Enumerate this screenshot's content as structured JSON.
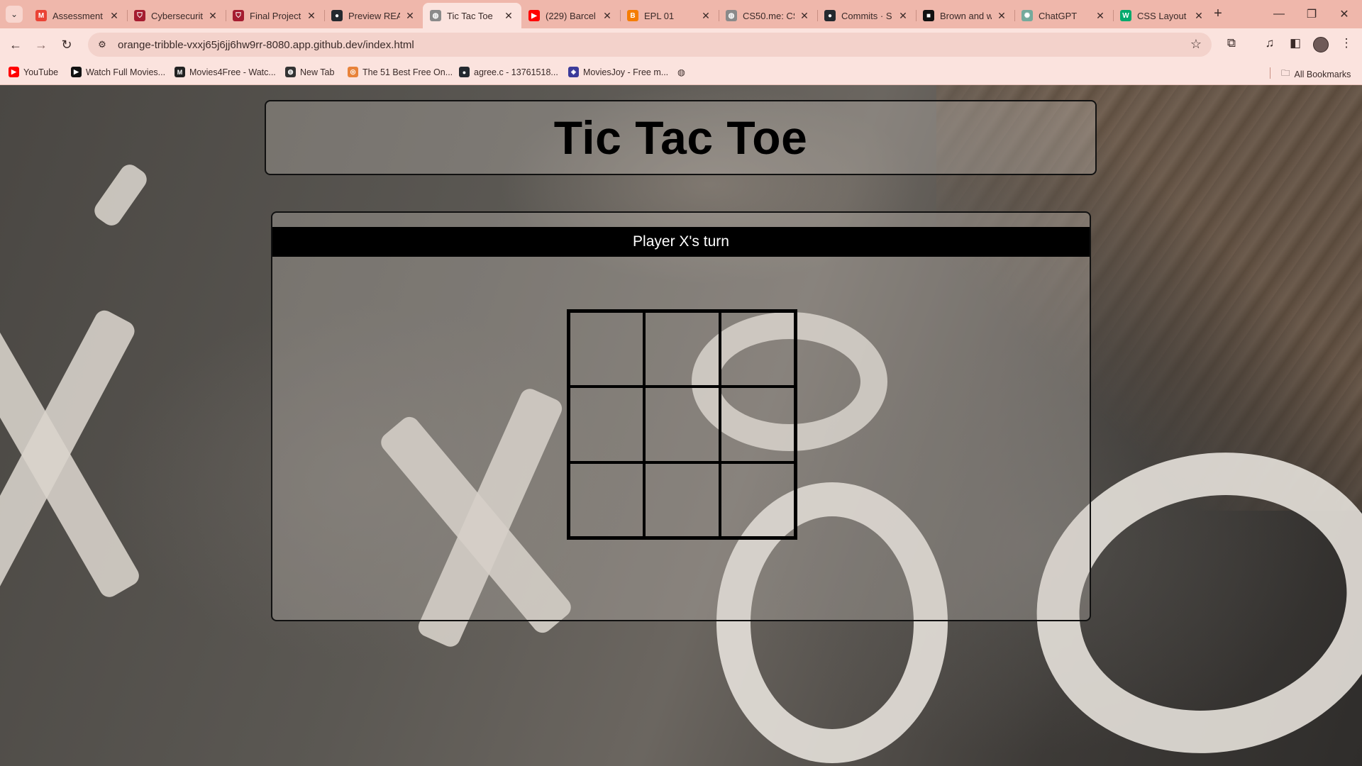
{
  "browser": {
    "tabs": [
      {
        "title": "Assessment",
        "favicon": "gmail-icon",
        "color": "#ea4335",
        "glyph": "M"
      },
      {
        "title": "Cybersecurit",
        "favicon": "harvard-shield-icon",
        "color": "#a51c30",
        "glyph": "⛉"
      },
      {
        "title": "Final Project",
        "favicon": "harvard-shield-icon",
        "color": "#a51c30",
        "glyph": "⛉"
      },
      {
        "title": "Preview REA",
        "favicon": "github-icon",
        "color": "#24292f",
        "glyph": "●"
      },
      {
        "title": "Tic Tac Toe",
        "favicon": "globe-icon",
        "color": "#8a8a8a",
        "glyph": "◍",
        "active": true
      },
      {
        "title": "(229) Barcel",
        "favicon": "youtube-icon",
        "color": "#ff0000",
        "glyph": "▶"
      },
      {
        "title": "EPL 01",
        "favicon": "blogger-icon",
        "color": "#f57d00",
        "glyph": "B"
      },
      {
        "title": "CS50.me: CS",
        "favicon": "globe-icon",
        "color": "#8a8a8a",
        "glyph": "◍"
      },
      {
        "title": "Commits · S",
        "favicon": "github-icon",
        "color": "#24292f",
        "glyph": "●"
      },
      {
        "title": "Brown and w",
        "favicon": "unsplash-icon",
        "color": "#111111",
        "glyph": "■"
      },
      {
        "title": "ChatGPT",
        "favicon": "chatgpt-icon",
        "color": "#74aa9c",
        "glyph": "✺"
      },
      {
        "title": "CSS Layout",
        "favicon": "w3schools-icon",
        "color": "#04aa6d",
        "glyph": "W"
      }
    ],
    "url": "orange-tribble-vxxj65j6jj6hw9rr-8080.app.github.dev/index.html",
    "bookmarks": [
      {
        "label": "YouTube",
        "favicon": "youtube-icon",
        "color": "#ff0000",
        "glyph": "▶"
      },
      {
        "label": "Watch Full Movies...",
        "favicon": "play-icon",
        "color": "#111111",
        "glyph": "▶"
      },
      {
        "label": "Movies4Free - Watc...",
        "favicon": "movies4free-icon",
        "color": "#222222",
        "glyph": "M"
      },
      {
        "label": "New Tab",
        "favicon": "globe-icon",
        "color": "#333333",
        "glyph": "◍"
      },
      {
        "label": "The 51 Best Free On...",
        "favicon": "list-icon",
        "color": "#e8833a",
        "glyph": "◎"
      },
      {
        "label": "agree.c - 13761518...",
        "favicon": "github-icon",
        "color": "#24292f",
        "glyph": "●"
      },
      {
        "label": "MoviesJoy - Free m...",
        "favicon": "moviesjoy-icon",
        "color": "#3b3b9a",
        "glyph": "◈"
      }
    ],
    "all_bookmarks": "All Bookmarks"
  },
  "page": {
    "title": "Tic Tac Toe",
    "status": "Player X's turn",
    "board": [
      "",
      "",
      "",
      "",
      "",
      "",
      "",
      "",
      ""
    ]
  }
}
